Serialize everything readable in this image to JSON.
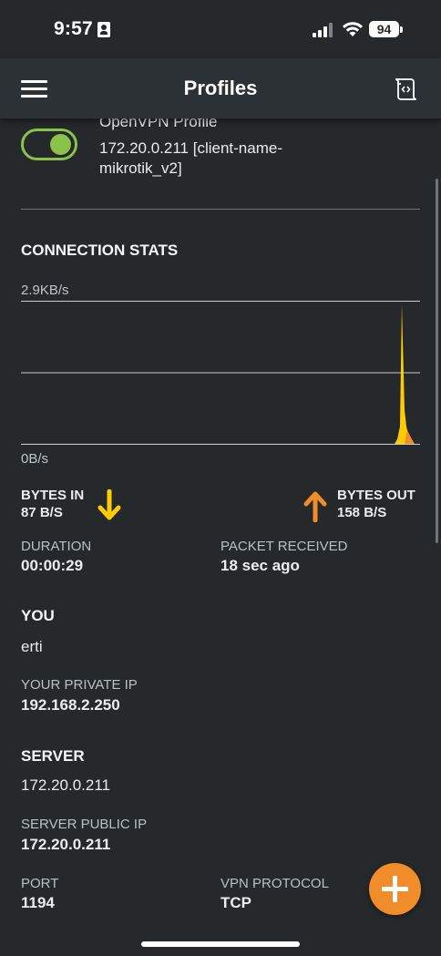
{
  "status_bar": {
    "time": "9:57",
    "battery": "94"
  },
  "header": {
    "title": "Profiles"
  },
  "profile": {
    "name": "OpenVPN Profile",
    "server": "172.20.0.211 [client-name-mikrotik_v2]",
    "enabled": true
  },
  "stats": {
    "title": "CONNECTION STATS",
    "chart_data": {
      "type": "area",
      "y_top_label": "2.9KB/s",
      "y_bottom_label": "0B/s",
      "colors": {
        "bytes_in": "#ffcc00",
        "bytes_out": "#f08c2a"
      }
    },
    "bytes_in_label": "BYTES IN",
    "bytes_in_value": "87 B/S",
    "bytes_out_label": "BYTES OUT",
    "bytes_out_value": "158 B/S",
    "duration_label": "DURATION",
    "duration_value": "00:00:29",
    "packet_label": "PACKET RECEIVED",
    "packet_value": "18 sec ago"
  },
  "you": {
    "title": "YOU",
    "username": "erti",
    "private_ip_label": "YOUR PRIVATE IP",
    "private_ip": "192.168.2.250"
  },
  "server": {
    "title": "SERVER",
    "address": "172.20.0.211",
    "public_ip_label": "SERVER PUBLIC IP",
    "public_ip": "172.20.0.211",
    "port_label": "PORT",
    "port": "1194",
    "protocol_label": "VPN PROTOCOL",
    "protocol": "TCP"
  },
  "icons": {
    "menu": "hamburger-icon",
    "import": "import-file-icon",
    "down": "arrow-down-icon",
    "up": "arrow-up-icon",
    "add": "plus-icon"
  }
}
